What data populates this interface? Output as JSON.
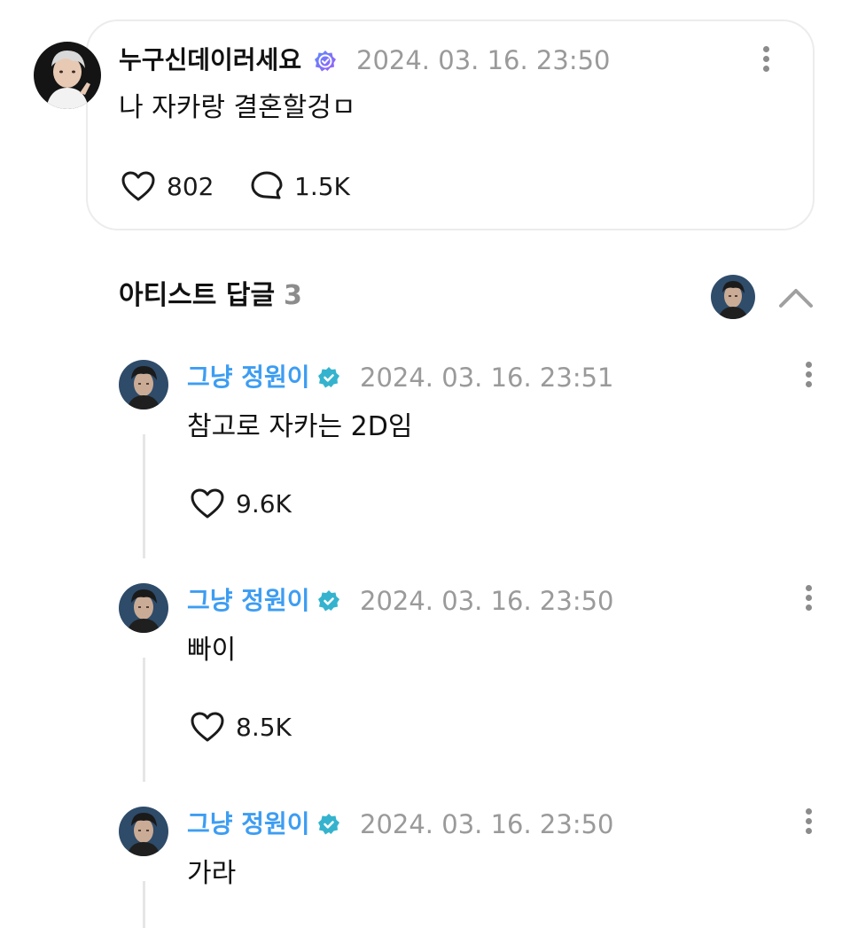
{
  "post": {
    "author": "누구신데이러세요",
    "timestamp": "2024. 03. 16. 23:50",
    "text": "나 자카랑 결혼할겅ㅁ",
    "likes": "802",
    "comments": "1.5K"
  },
  "artist_replies": {
    "title": "아티스트 답글",
    "count": "3"
  },
  "replies": [
    {
      "author": "그냥 정원이",
      "timestamp": "2024. 03. 16. 23:51",
      "text": "참고로 자카는 2D임",
      "likes": "9.6K"
    },
    {
      "author": "그냥 정원이",
      "timestamp": "2024. 03. 16. 23:50",
      "text": "빠이",
      "likes": "8.5K"
    },
    {
      "author": "그냥 정원이",
      "timestamp": "2024. 03. 16. 23:50",
      "text": "가라"
    }
  ],
  "colors": {
    "artist_name": "#3d9df2",
    "timestamp": "#9a9a9a",
    "verified_badge": "#35b3ce"
  }
}
